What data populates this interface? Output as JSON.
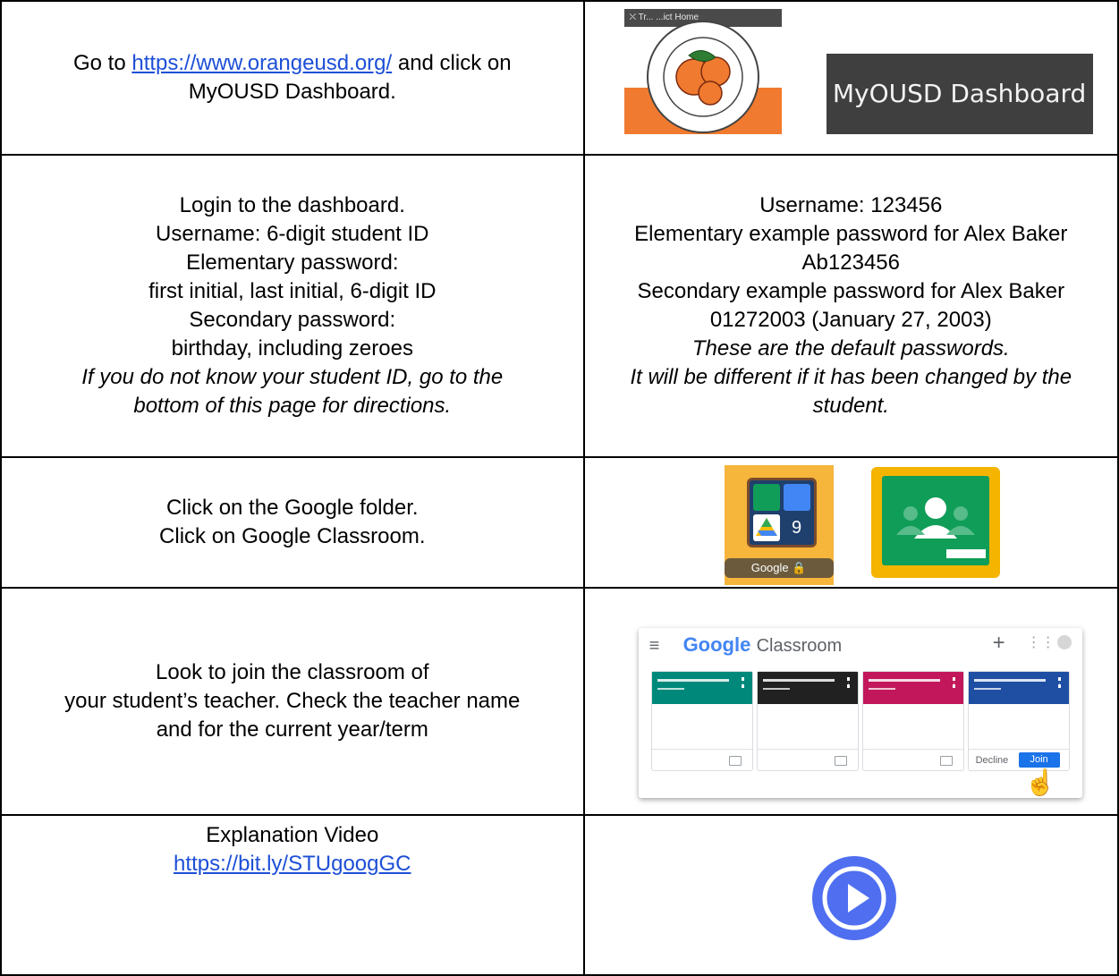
{
  "rows": [
    {
      "left": {
        "prefix": "Go to ",
        "link": "https://www.orangeusd.org/",
        "suffix": " and click on",
        "line2": "MyOUSD Dashboard."
      },
      "right": {
        "seal_topbar": "⛌ Tr... ...ict Home",
        "dashboard_button": "MyOUSD Dashboard"
      }
    },
    {
      "left": {
        "lines": [
          "Login to the dashboard.",
          "Username: 6-digit student ID",
          "Elementary password:",
          "first initial, last initial, 6-digit ID",
          "Secondary password:",
          "birthday, including zeroes"
        ],
        "italic_lines": [
          "If you do not know your student ID, go to the",
          "bottom of this page for directions."
        ]
      },
      "right": {
        "lines": [
          "Username: 123456",
          "Elementary example password for Alex Baker",
          "Ab123456",
          "Secondary example password for Alex Baker",
          "01272003 (January 27, 2003)"
        ],
        "italic_lines": [
          "These are the default passwords.",
          "It will be different if it has been changed by the",
          "student."
        ]
      }
    },
    {
      "left": {
        "lines": [
          "Click on the Google folder.",
          "Click on Google Classroom."
        ]
      },
      "right": {
        "folder_label": "Google 🔒",
        "folder_count": "9"
      }
    },
    {
      "left": {
        "lines": [
          "Look to join the classroom of",
          "your student’s teacher. Check the teacher name",
          "and for the current year/term"
        ]
      },
      "right": {
        "brand": "Google",
        "product": "Classroom",
        "plus": "+",
        "grid": "⋮⋮⋮",
        "decline": "Decline",
        "join": "Join",
        "class_colors": [
          "#00897b",
          "#212121",
          "#c2185b",
          "#1e4fa3"
        ]
      }
    },
    {
      "left": {
        "title": "Explanation Video",
        "link": "https://bit.ly/STUgoogGC"
      },
      "right": {
        "icon": "play-icon"
      }
    }
  ]
}
